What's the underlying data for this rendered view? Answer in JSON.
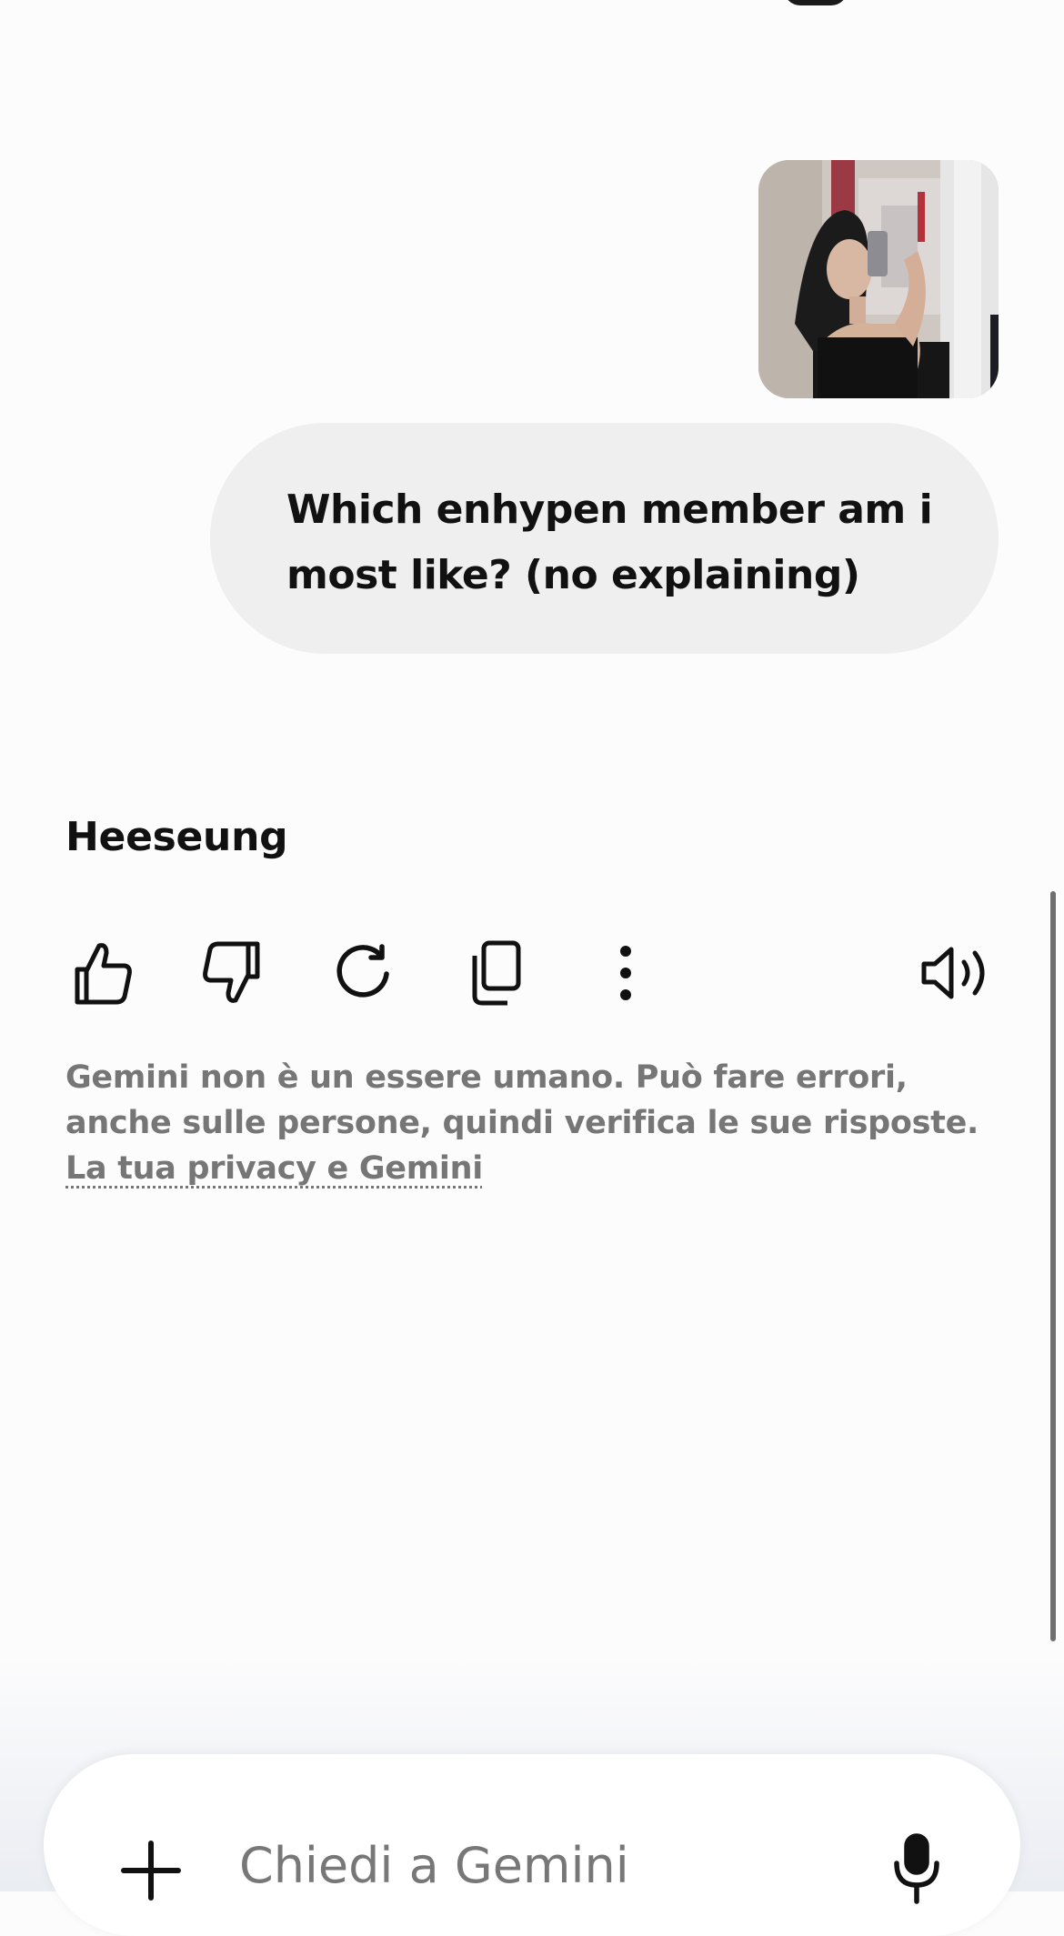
{
  "chat": {
    "user_message": "Which enhypen member am i most like? (no explaining)",
    "model_response": "Heeseung"
  },
  "actions": {
    "icons": [
      "thumbs-up-icon",
      "thumbs-down-icon",
      "regenerate-icon",
      "copy-icon",
      "more-options-icon",
      "speaker-icon"
    ]
  },
  "disclaimer": {
    "text": "Gemini non è un essere umano. Può fare errori, anche sulle persone, quindi verifica le sue risposte. ",
    "link_label": "La tua privacy e Gemini"
  },
  "input": {
    "placeholder": "Chiedi a Gemini"
  }
}
